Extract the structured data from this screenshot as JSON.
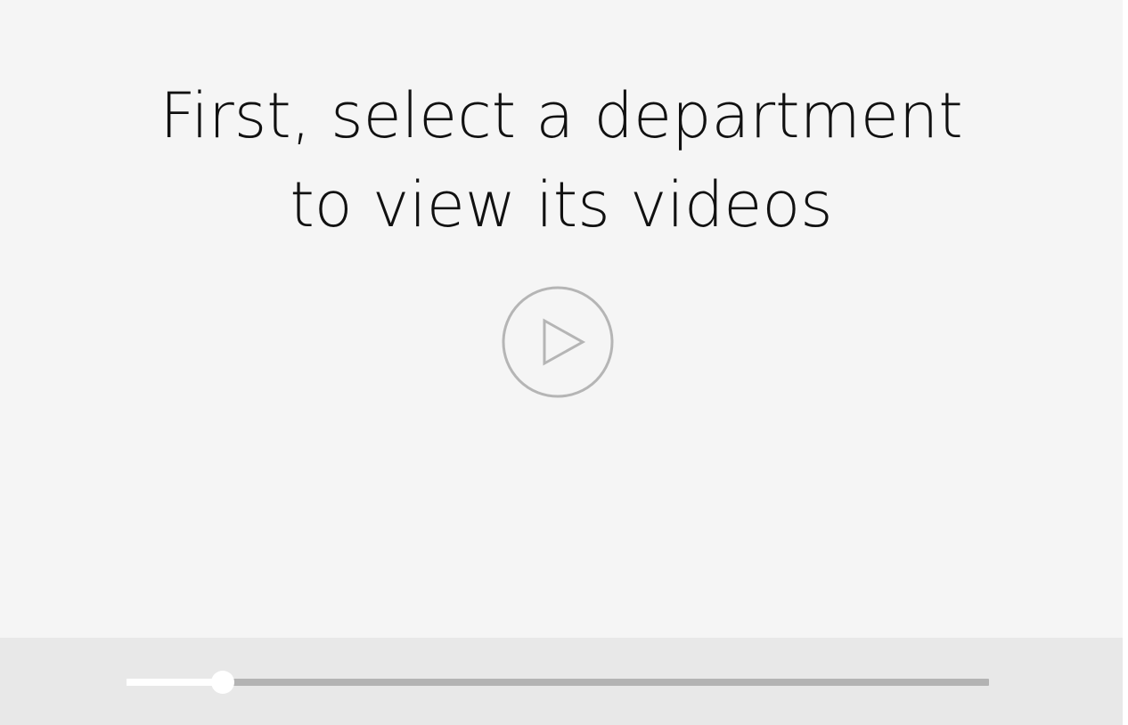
{
  "player": {
    "prompt_lines": [
      "First, select a department",
      "to view its videos"
    ],
    "play_icon": "play-circle-icon",
    "progress": 0.112
  },
  "colors": {
    "stage_background": "#f5f5f5",
    "controls_background": "#e8e8e8",
    "track_color": "#b3b3b3",
    "played_color": "#ffffff",
    "icon_color": "#b5b5b5",
    "text_color": "#111111"
  }
}
